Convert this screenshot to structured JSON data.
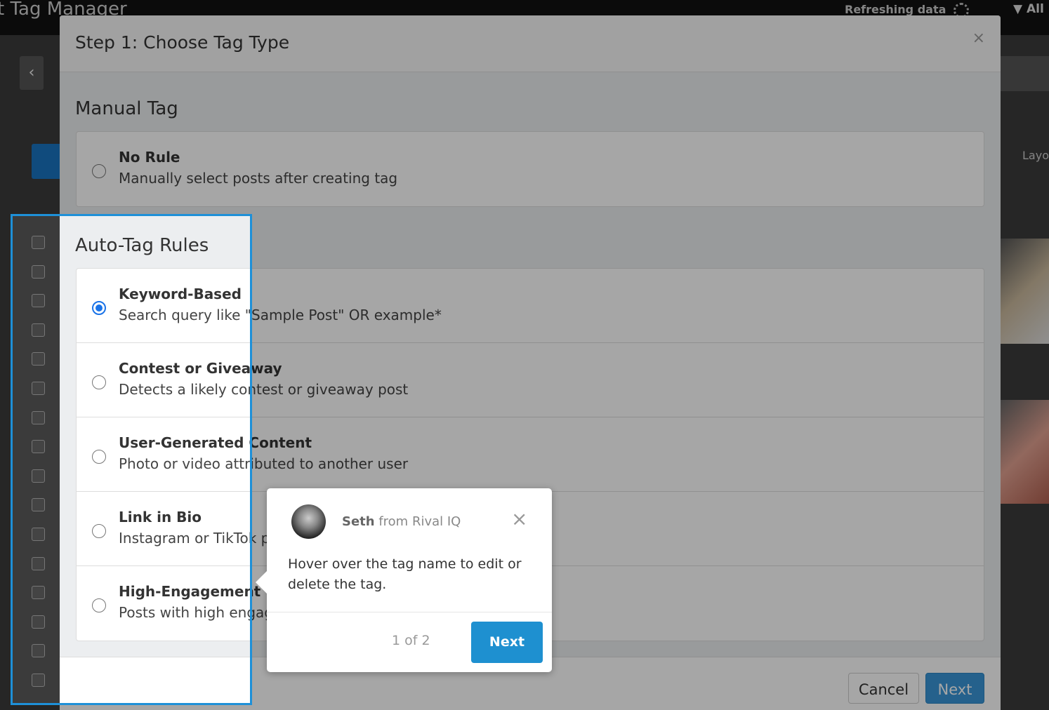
{
  "app": {
    "title": "t Tag Manager",
    "refreshing": "Refreshing data",
    "filter": "All",
    "layout_label": "Layo"
  },
  "modal": {
    "title": "Step 1: Choose Tag Type",
    "close": "×",
    "manual": {
      "heading": "Manual Tag",
      "options": [
        {
          "title": "No Rule",
          "desc": "Manually select posts after creating tag",
          "selected": false
        }
      ]
    },
    "auto": {
      "heading": "Auto-Tag Rules",
      "options": [
        {
          "title": "Keyword-Based",
          "desc": "Search query like \"Sample Post\" OR example*",
          "selected": true
        },
        {
          "title": "Contest or Giveaway",
          "desc": "Detects a likely contest or giveaway post",
          "selected": false
        },
        {
          "title": "User-Generated Content",
          "desc": "Photo or video attributed to another user",
          "selected": false
        },
        {
          "title": "Link in Bio",
          "desc": "Instagram or TikTok p",
          "selected": false
        },
        {
          "title": "High-Engagement De",
          "desc": "Posts with high engag",
          "selected": false
        }
      ]
    },
    "cancel": "Cancel",
    "next": "Next"
  },
  "tooltip": {
    "sender": "Seth",
    "from": "from Rival IQ",
    "close": "×",
    "body": "Hover over the tag name to edit or delete the tag.",
    "count": "1 of 2",
    "next": "Next"
  },
  "colors": {
    "accent": "#1e90d0",
    "radio": "#1a73e8"
  }
}
